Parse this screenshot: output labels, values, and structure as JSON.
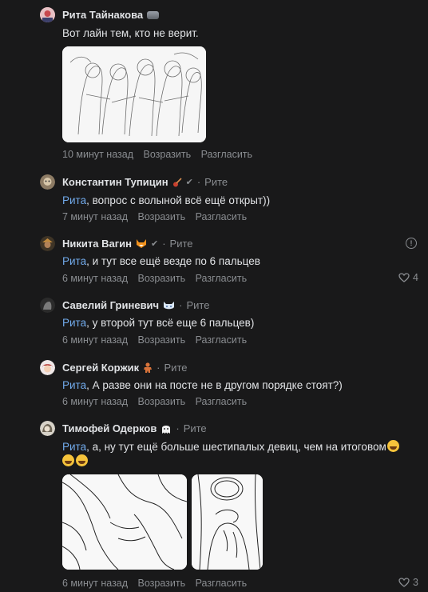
{
  "comments": [
    {
      "author": "Рита Тайнакова",
      "text": "Вот лайн тем, кто не верит.",
      "time": "10 минут назад",
      "reply_label": "Возразить",
      "disagree_label": "Разгласить"
    },
    {
      "author": "Константин Тупицин",
      "reply_to": "Рите",
      "mention": "Рита",
      "text": ", вопрос с волыной всё ещё открыт))",
      "time": "7 минут назад",
      "reply_label": "Возразить",
      "disagree_label": "Разгласить"
    },
    {
      "author": "Никита Вагин",
      "reply_to": "Рите",
      "mention": "Рита",
      "text": ", и тут все ещё везде по 6 пальцев",
      "time": "6 минут назад",
      "reply_label": "Возразить",
      "disagree_label": "Разгласить",
      "likes": "4"
    },
    {
      "author": "Савелий Гриневич",
      "reply_to": "Рите",
      "mention": "Рита",
      "text": ", у второй тут всё еще 6 пальцев)",
      "time": "6 минут назад",
      "reply_label": "Возразить",
      "disagree_label": "Разгласить"
    },
    {
      "author": "Сергей Коржик",
      "reply_to": "Рите",
      "mention": "Рита",
      "text": ", А разве они на посте не в другом порядке стоят?)",
      "time": "6 минут назад",
      "reply_label": "Возразить",
      "disagree_label": "Разгласить"
    },
    {
      "author": "Тимофей Одерков",
      "reply_to": "Рите",
      "mention": "Рита",
      "text": ", а, ну тут ещё больше шестипалых девиц, чем на итоговом",
      "time": "6 минут назад",
      "reply_label": "Возразить",
      "disagree_label": "Разгласить",
      "likes": "3"
    }
  ],
  "separator": "·",
  "icons": {
    "verified": "check-icon",
    "like": "heart-icon",
    "report": "info-icon",
    "emoji_laugh": "laughing-emoji-icon"
  },
  "colors": {
    "background": "#19191a",
    "text": "#e1e3e6",
    "secondary": "#8a8d91",
    "mention": "#71aaeb"
  }
}
